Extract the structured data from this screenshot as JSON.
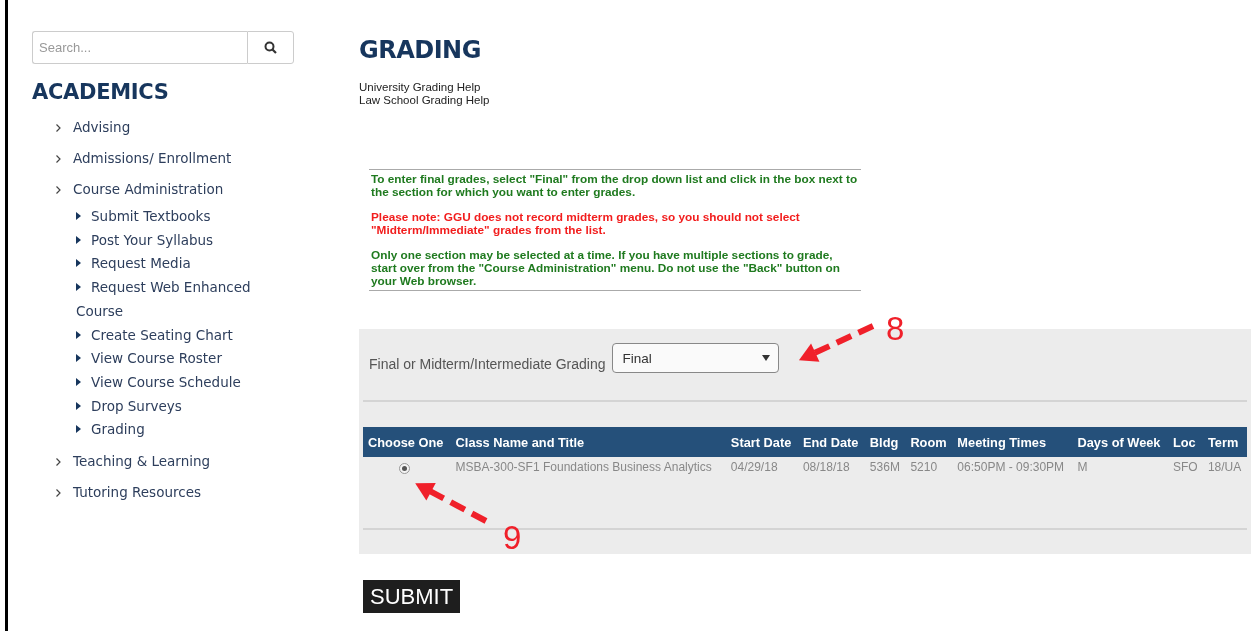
{
  "sidebar": {
    "search": {
      "placeholder": "Search..."
    },
    "heading": "ACADEMICS",
    "items": [
      {
        "label": "Advising"
      },
      {
        "label": "Admissions/ Enrollment"
      },
      {
        "label": "Course Administration",
        "children": [
          {
            "label": "Submit Textbooks"
          },
          {
            "label": "Post Your Syllabus"
          },
          {
            "label": "Request Media"
          },
          {
            "label": "Request Web Enhanced Course"
          },
          {
            "label": "Create Seating Chart"
          },
          {
            "label": "View Course Roster"
          },
          {
            "label": "View Course Schedule"
          },
          {
            "label": "Drop Surveys"
          },
          {
            "label": "Grading"
          }
        ]
      },
      {
        "label": "Teaching & Learning"
      },
      {
        "label": "Tutoring Resources"
      }
    ]
  },
  "main": {
    "title": "GRADING",
    "help_links": [
      "University Grading Help",
      "Law School Grading Help"
    ],
    "instructions": [
      {
        "kind": "info",
        "text": "To enter final grades, select \"Final\" from the drop down list and click in the box next to the section for which you want to enter grades."
      },
      {
        "kind": "warning",
        "text": "Please note: GGU does not record midterm grades, so you should not select \"Midterm/Immediate\" grades from the list."
      },
      {
        "kind": "info",
        "text": "Only one section may be selected at a time. If you have multiple sections to grade, start over from the \"Course Administration\" menu. Do not use the \"Back\" button on your Web browser."
      }
    ],
    "grading_type": {
      "label": "Final or Midterm/Intermediate Grading",
      "value": "Final"
    },
    "table": {
      "columns": [
        "Choose One",
        "Class Name and Title",
        "Start Date",
        "End Date",
        "Bldg",
        "Room",
        "Meeting Times",
        "Days of Week",
        "Loc",
        "Term"
      ],
      "rows": [
        {
          "selected": true,
          "cells": [
            "",
            "MSBA-300-SF1 Foundations Business Analytics",
            "04/29/18",
            "08/18/18",
            "536M",
            "5210",
            "06:50PM - 09:30PM",
            "M",
            "SFO",
            "18/UA"
          ]
        }
      ]
    },
    "submit": "SUBMIT"
  },
  "annotations": [
    {
      "number": "8"
    },
    {
      "number": "9"
    }
  ]
}
